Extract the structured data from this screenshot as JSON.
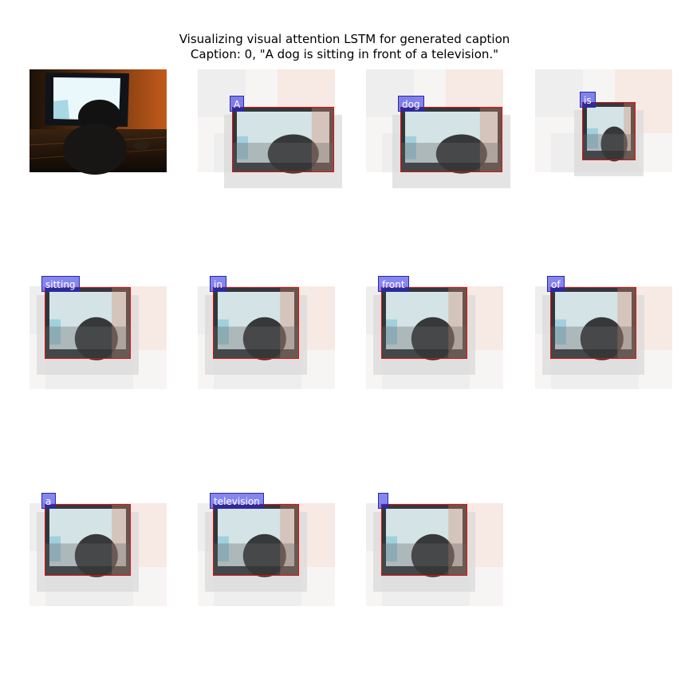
{
  "figure": {
    "title_line1": "Visualizing visual attention LSTM for generated caption",
    "title_line2": "Caption: 0, \"A dog is sitting in front of a television.\""
  },
  "original_image": {
    "description_icon": "dog-watching-tv-photo-icon"
  },
  "panels": [
    {
      "word": "A"
    },
    {
      "word": "dog"
    },
    {
      "word": "is"
    },
    {
      "word": "sitting"
    },
    {
      "word": "in"
    },
    {
      "word": "front"
    },
    {
      "word": "of"
    },
    {
      "word": "a"
    },
    {
      "word": "television"
    },
    {
      "word": ""
    }
  ],
  "colors": {
    "label_bg": "#4a4af0",
    "bbox": "#e01010",
    "tv_screen": "#e8f6fb",
    "wood": "#b5531c"
  }
}
